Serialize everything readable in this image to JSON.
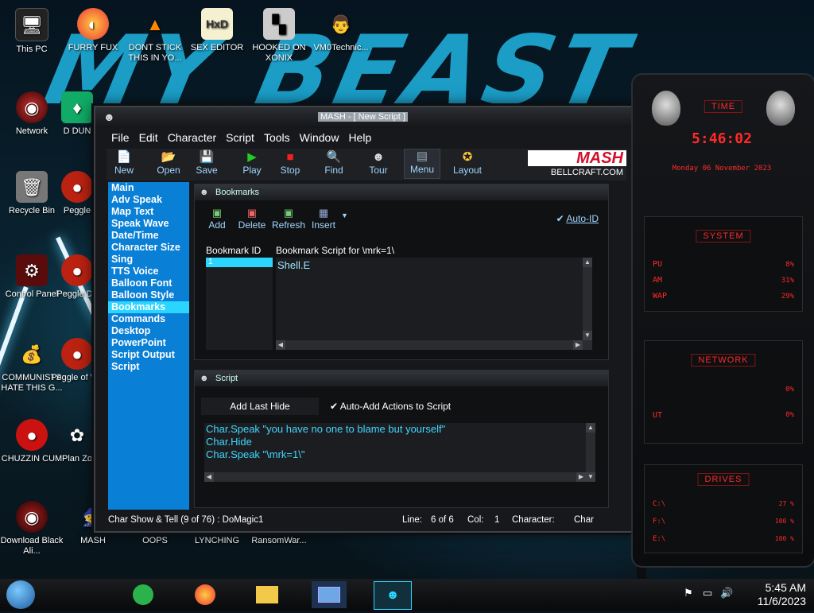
{
  "desktop_icons": [
    {
      "label": "This PC",
      "icon": "pc-icon"
    },
    {
      "label": "FURRY FUX",
      "icon": "firefox-icon"
    },
    {
      "label": "DONT STICK THIS IN YO...",
      "icon": "vlc-icon"
    },
    {
      "label": "SEX EDITOR",
      "icon": "hxd-icon"
    },
    {
      "label": "HOOKED ON XONIX",
      "icon": "xonix-icon"
    },
    {
      "label": "VM0Technic...",
      "icon": "doctor-icon"
    },
    {
      "label": "Network",
      "icon": "network-icon"
    },
    {
      "label": "Recycle Bin",
      "icon": "recycle-bin-icon"
    },
    {
      "label": "Control Panel",
      "icon": "control-panel-icon"
    },
    {
      "label": "COMMUNISTS HATE THIS G...",
      "icon": "money-bag-icon"
    },
    {
      "label": "CHUZZIN CUM",
      "icon": "chuzzle-icon"
    },
    {
      "label": "Download Black Ali...",
      "icon": "alien-orb-icon"
    },
    {
      "label": "MASH",
      "icon": "mash-icon"
    },
    {
      "label": "OOPS",
      "icon": "oops-icon"
    },
    {
      "label": "LYNCHING",
      "icon": "lynching-icon"
    },
    {
      "label": "RansomWar...",
      "icon": "ransomware-icon"
    },
    {
      "label": "Peggle",
      "icon": "peggle-icon"
    },
    {
      "label": "Peggle De",
      "icon": "peggle-icon"
    },
    {
      "label": "Peggle of Wa",
      "icon": "peggle-icon"
    },
    {
      "label": "Plan Zo",
      "icon": "plants-icon"
    },
    {
      "label": "D DUN",
      "icon": "dungeon-icon"
    }
  ],
  "window": {
    "title": "MASH - [ New Script ]",
    "menu": [
      "File",
      "Edit",
      "Character",
      "Script",
      "Tools",
      "Window",
      "Help"
    ],
    "toolbar": [
      {
        "label": "New",
        "icon": "new-file-icon"
      },
      {
        "label": "Open",
        "icon": "open-folder-icon"
      },
      {
        "label": "Save",
        "icon": "save-disk-icon"
      },
      {
        "label": "Play",
        "icon": "play-icon"
      },
      {
        "label": "Stop",
        "icon": "stop-icon"
      },
      {
        "label": "Find",
        "icon": "find-icon"
      },
      {
        "label": "Tour",
        "icon": "tour-icon"
      },
      {
        "label": "Menu",
        "icon": "menu-icon"
      },
      {
        "label": "Layout",
        "icon": "layout-icon"
      }
    ],
    "logo": {
      "brand": "MASH",
      "url": "BELLCRAFT.COM"
    },
    "sidebar": [
      "Main",
      "Adv Speak",
      "Map Text",
      "Speak Wave",
      "Date/Time",
      "Character Size",
      "Sing",
      "TTS Voice",
      "Balloon Font",
      "Balloon Style",
      "Bookmarks",
      "Commands",
      "Desktop",
      "PowerPoint",
      "Script Output",
      "Script"
    ],
    "sidebar_selected": "Bookmarks",
    "bookmarks": {
      "header": "Bookmarks",
      "tools": [
        {
          "label": "Add",
          "icon": "add-icon"
        },
        {
          "label": "Delete",
          "icon": "delete-icon"
        },
        {
          "label": "Refresh",
          "icon": "refresh-icon"
        },
        {
          "label": "Insert",
          "icon": "insert-icon"
        }
      ],
      "auto_id": "Auto-ID",
      "id_label": "Bookmark ID",
      "script_label": "Bookmark Script for \\mrk=1\\",
      "selected_id": "1",
      "script_text": "Shell.E"
    },
    "script": {
      "header": "Script",
      "add_last_hide": "Add Last Hide",
      "auto_add": "Auto-Add Actions to Script",
      "lines": [
        "Char.Speak \"you have no one to blame but yourself\"",
        "Char.Hide",
        "Char.Speak \"\\mrk=1\\\""
      ]
    },
    "status": {
      "left": "Char Show & Tell (9 of 76) : DoMagic1",
      "line_label": "Line:",
      "line_value": "6 of 6",
      "col_label": "Col:",
      "col_value": "1",
      "char_label": "Character:",
      "char_value": "Char"
    }
  },
  "gadget": {
    "time_title": "TIME",
    "time": "5:46:02",
    "date": "Monday 06 November 2023",
    "system_title": "SYSTEM",
    "system_rows": [
      {
        "label": "PU",
        "value": "8%"
      },
      {
        "label": "AM",
        "value": "31%"
      },
      {
        "label": "WAP",
        "value": "29%"
      }
    ],
    "network_title": "NETWORK",
    "network_rows": [
      {
        "value": "0%"
      },
      {
        "label": "UT",
        "value": "0%"
      }
    ],
    "drives_title": "DRIVES",
    "drives_rows": [
      {
        "label": "C:\\",
        "value": "27 %"
      },
      {
        "label": "F:\\",
        "value": "100 %"
      },
      {
        "label": "E:\\",
        "value": "100 %"
      }
    ],
    "accent": "#ff2a2a"
  },
  "taskbar": {
    "time": "5:45 AM",
    "date": "11/6/2023",
    "icons": [
      "start-orb-icon",
      "feedly-icon",
      "firefox-icon",
      "file-explorer-icon",
      "control-panel-icon",
      "mash-icon"
    ]
  }
}
